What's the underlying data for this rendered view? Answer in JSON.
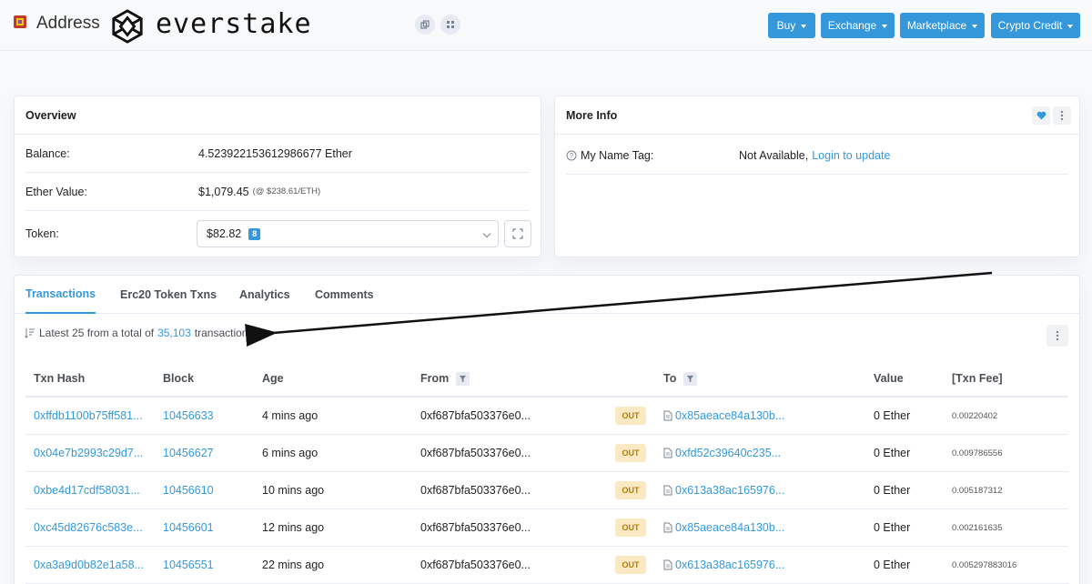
{
  "header": {
    "address_label": "Address",
    "brand": "everstake",
    "nav": [
      {
        "label": "Buy"
      },
      {
        "label": "Exchange"
      },
      {
        "label": "Marketplace"
      },
      {
        "label": "Crypto Credit"
      }
    ]
  },
  "overview": {
    "title": "Overview",
    "balance_label": "Balance:",
    "balance_value": "4.523922153612986677 Ether",
    "ether_value_label": "Ether Value:",
    "ether_value": "$1,079.45",
    "ether_rate": "(@ $238.61/ETH)",
    "token_label": "Token:",
    "token_value": "$82.82",
    "token_count": "8"
  },
  "more_info": {
    "title": "More Info",
    "name_tag_label": "My Name Tag:",
    "name_tag_value": "Not Available,",
    "name_tag_link": "Login to update"
  },
  "tabs": [
    {
      "label": "Transactions",
      "active": true
    },
    {
      "label": "Erc20 Token Txns"
    },
    {
      "label": "Analytics"
    },
    {
      "label": "Comments"
    }
  ],
  "summary": {
    "prefix": "Latest 25 from a total of",
    "count": "35,103",
    "suffix": "transactions"
  },
  "columns": {
    "hash": "Txn Hash",
    "block": "Block",
    "age": "Age",
    "from": "From",
    "to": "To",
    "value": "Value",
    "fee": "[Txn Fee]"
  },
  "rows": [
    {
      "hash": "0xffdb1100b75ff581...",
      "block": "10456633",
      "age": "4 mins ago",
      "from": "0xf687bfa503376e0...",
      "dir": "OUT",
      "to": "0x85aeace84a130b...",
      "value": "0 Ether",
      "fee": "0.00220402"
    },
    {
      "hash": "0x04e7b2993c29d7...",
      "block": "10456627",
      "age": "6 mins ago",
      "from": "0xf687bfa503376e0...",
      "dir": "OUT",
      "to": "0xfd52c39640c235...",
      "value": "0 Ether",
      "fee": "0.009786556"
    },
    {
      "hash": "0xbe4d17cdf58031...",
      "block": "10456610",
      "age": "10 mins ago",
      "from": "0xf687bfa503376e0...",
      "dir": "OUT",
      "to": "0x613a38ac165976...",
      "value": "0 Ether",
      "fee": "0.005187312"
    },
    {
      "hash": "0xc45d82676c583e...",
      "block": "10456601",
      "age": "12 mins ago",
      "from": "0xf687bfa503376e0...",
      "dir": "OUT",
      "to": "0x85aeace84a130b...",
      "value": "0 Ether",
      "fee": "0.002161635"
    },
    {
      "hash": "0xa3a9d0b82e1a58...",
      "block": "10456551",
      "age": "22 mins ago",
      "from": "0xf687bfa503376e0...",
      "dir": "OUT",
      "to": "0x613a38ac165976...",
      "value": "0 Ether",
      "fee": "0.005297883016"
    }
  ],
  "colors": {
    "accent": "#3498db",
    "out_badge_bg": "#fbe9c4",
    "out_badge_text": "#b47d00"
  }
}
